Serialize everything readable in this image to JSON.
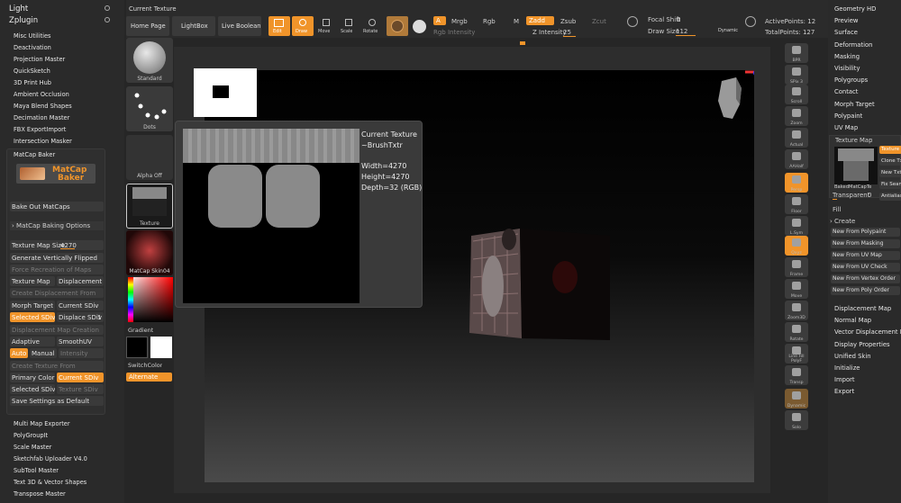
{
  "zplugin": {
    "light_label": "Light",
    "zplugin_label": "Zplugin",
    "items_top": [
      "Misc Utilities",
      "Deactivation",
      "Projection Master",
      "QuickSketch",
      "3D Print Hub",
      "Ambient Occlusion",
      "Maya Blend Shapes",
      "Decimation Master",
      "FBX ExportImport",
      "Intersection Masker",
      "MatCap Baker"
    ],
    "items_bottom": [
      "Multi Map Exporter",
      "PolyGroupIt",
      "Scale Master",
      "Sketchfab Uploader V4.0",
      "SubTool Master",
      "Text 3D & Vector Shapes",
      "Transpose Master"
    ]
  },
  "matcap_baker": {
    "logo_text_1": "MatCap",
    "logo_text_2": "Baker",
    "bake_out": "Bake Out MatCaps",
    "baking_options": "› MatCap Baking Options",
    "texture_map_size_label": "Texture Map Size",
    "texture_map_size_value": "4270",
    "generate_flipped": "Generate Vertically Flipped",
    "force_recreation": "Force Recreation of Maps",
    "texture_map": "Texture Map",
    "displacement_map": "Displacement Map",
    "create_displacement_from": "Create Displacement From",
    "morph_target": "Morph Target",
    "current_sdiv": "Current SDiv",
    "selected_sdiv": "Selected SDiv",
    "displace_sdiv": "Displace SDiv",
    "displace_sdiv_value": "1",
    "displacement_map_creation": "Displacement Map Creation",
    "adaptive": "Adaptive",
    "smooth_uv": "SmoothUV",
    "auto": "Auto",
    "manual": "Manual",
    "intensity": "Intensity",
    "create_texture_from": "Create Texture From",
    "primary_color": "Primary Color",
    "current_sdiv_2": "Current SDiv",
    "selected_sdiv_2": "Selected SDiv",
    "texture_sdiv": "Texture SDiv",
    "save_settings": "Save Settings as Default"
  },
  "brush_column": {
    "current_texture_header": "Current Texture",
    "standard": "Standard",
    "dots": "Dots",
    "alpha_off": "Alpha Off",
    "texture": "Texture",
    "matcap": "MatCap Skin04",
    "gradient": "Gradient",
    "switch_color": "SwitchColor",
    "alternate": "Alternate"
  },
  "toolbar": {
    "home_page": "Home Page",
    "lightbox": "LightBox",
    "live_boolean": "Live Boolean",
    "edit": "Edit",
    "draw": "Draw",
    "move": "Move",
    "scale": "Scale",
    "rotate": "Rotate",
    "a": "A",
    "mrgb": "Mrgb",
    "rgb": "Rgb",
    "m": "M",
    "zadd": "Zadd",
    "zsub": "Zsub",
    "zcut": "Zcut",
    "rgb_intensity": "Rgb Intensity",
    "z_intensity_label": "Z Intensity",
    "z_intensity_value": "25",
    "focal_shift_label": "Focal Shift",
    "focal_shift_value": "0",
    "draw_size_label": "Draw Size",
    "draw_size_value": "112",
    "dynamic": "Dynamic",
    "active_points": "ActivePoints: 12",
    "total_points": "TotalPoints: 127"
  },
  "popup": {
    "title": "Current Texture",
    "name": "~BrushTxtr",
    "width": "Width=4270",
    "height": "Height=4270",
    "depth": "Depth=32 (RGB)"
  },
  "right_tools": [
    "BPR",
    "SPix 3",
    "Scroll",
    "Zoom",
    "Actual",
    "AAHalf",
    "Persp",
    "Floor",
    "L.Sym",
    "Qxyz",
    "Frame",
    "Move",
    "Zoom3D",
    "Rotate",
    "Line Fill PolyF",
    "Transp",
    "Dynamic",
    "Solo"
  ],
  "right_menu": {
    "items_top": [
      "Geometry HD",
      "Preview",
      "Surface",
      "Deformation",
      "Masking",
      "Visibility",
      "Polygroups",
      "Contact",
      "Morph Target",
      "Polypaint",
      "UV Map"
    ],
    "texture_map": "Texture Map",
    "texture_on": "Texture On",
    "clone_txtr": "Clone Txtr",
    "new_txtr": "New Txtr",
    "fix_seam": "Fix Seam",
    "antialias": "Antialias",
    "baked_name": "BakedMatCapTe",
    "transparent_label": "Transparent",
    "transparent_value": "0",
    "fill": "Fill",
    "create": "› Create",
    "create_items": [
      "New From Polypaint",
      "New From Masking",
      "New From UV Map",
      "New From UV Check",
      "New From Vertex Order",
      "New From Poly Order"
    ],
    "items_bottom": [
      "Displacement Map",
      "Normal Map",
      "Vector Displacement Ma",
      "Display Properties",
      "Unified Skin",
      "Initialize",
      "Import",
      "Export"
    ]
  },
  "colors": {
    "accent": "#f0942a",
    "panel": "#2a2a2a",
    "canvas": "#000000"
  }
}
